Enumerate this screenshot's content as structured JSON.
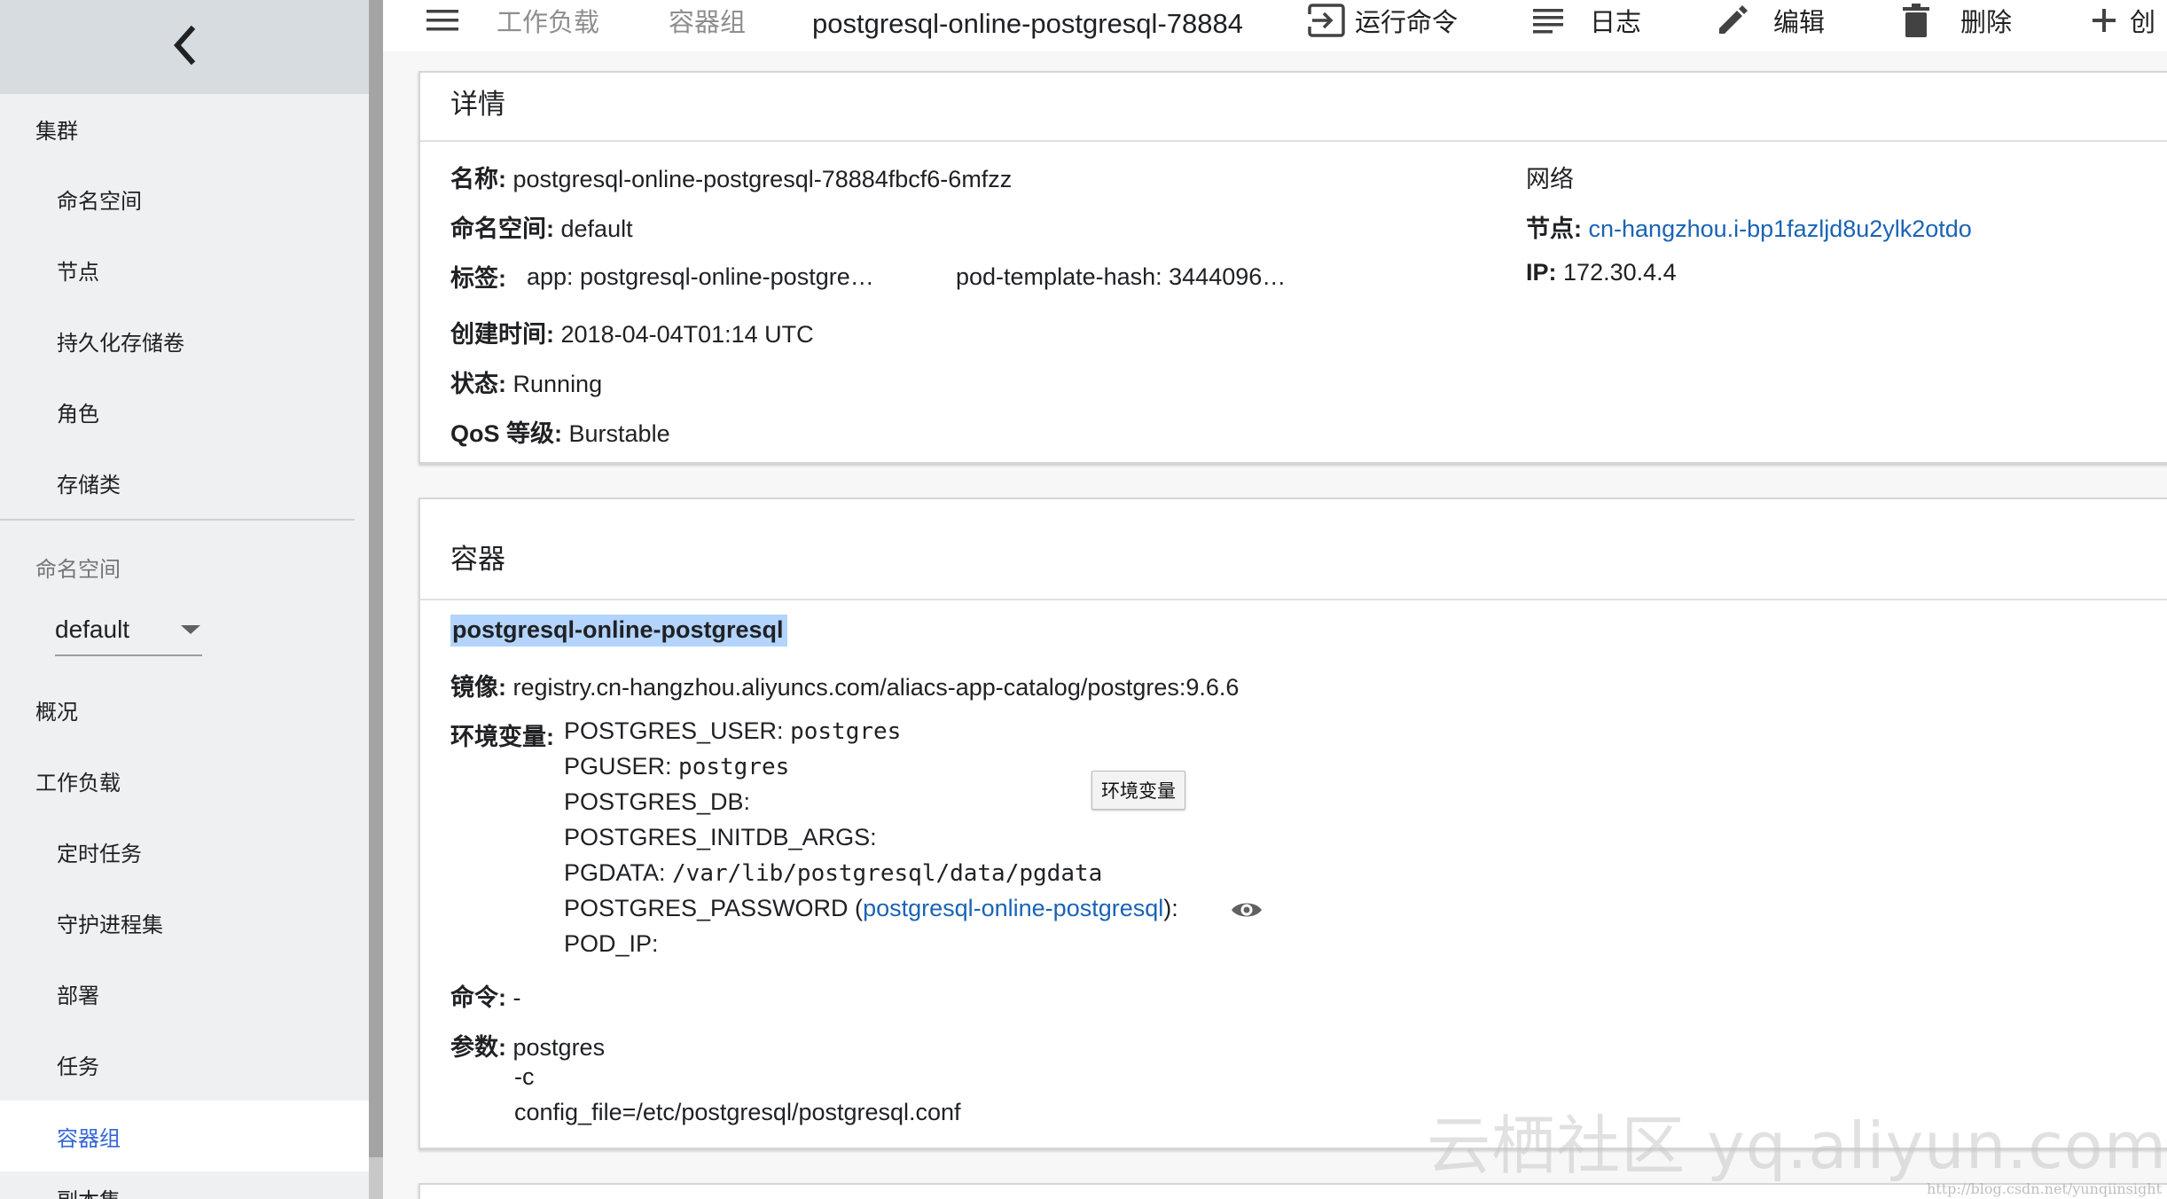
{
  "toolbar": {
    "crumbs": [
      "工作负载",
      "容器组"
    ],
    "title": "postgresql-online-postgresql-78884",
    "actions": [
      "运行命令",
      "日志",
      "编辑",
      "删除",
      "创"
    ]
  },
  "sidebar": {
    "items": [
      {
        "label": "集群"
      },
      {
        "label": "命名空间"
      },
      {
        "label": "节点"
      },
      {
        "label": "持久化存储卷"
      },
      {
        "label": "角色"
      },
      {
        "label": "存储类"
      },
      {
        "label": "概况"
      },
      {
        "label": "工作负载"
      },
      {
        "label": "定时任务"
      },
      {
        "label": "守护进程集"
      },
      {
        "label": "部署"
      },
      {
        "label": "任务"
      },
      {
        "label": "容器组"
      },
      {
        "label": "副本集"
      }
    ],
    "namespace_label": "命名空间",
    "namespace_value": "default"
  },
  "details": {
    "title": "详情",
    "name_label": "名称:",
    "name_value": "postgresql-online-postgresql-78884fbcf6-6mfzz",
    "namespace_label": "命名空间:",
    "namespace_value": "default",
    "labels_label": "标签:",
    "label_1": "app: postgresql-online-postgre…",
    "label_2": "pod-template-hash: 3444096…",
    "created_label": "创建时间:",
    "created_value": "2018-04-04T01:14 UTC",
    "status_label": "状态:",
    "status_value": "Running",
    "qos_label": "QoS 等级:",
    "qos_value": "Burstable",
    "network_title": "网络",
    "node_label": "节点:",
    "node_value": "cn-hangzhou.i-bp1fazljd8u2ylk2otdo",
    "ip_label": "IP:",
    "ip_value": "172.30.4.4"
  },
  "containers": {
    "title": "容器",
    "container_name": "postgresql-online-postgresql",
    "image_label": "镜像:",
    "image_value": "registry.cn-hangzhou.aliyuncs.com/aliacs-app-catalog/postgres:9.6.6",
    "env_label": "环境变量:",
    "env": [
      {
        "key": "POSTGRES_USER:",
        "value": "postgres"
      },
      {
        "key": "PGUSER:",
        "value": "postgres"
      },
      {
        "key": "POSTGRES_DB:",
        "value": ""
      },
      {
        "key": "POSTGRES_INITDB_ARGS:",
        "value": ""
      },
      {
        "key": "PGDATA:",
        "value": "/var/lib/postgresql/data/pgdata"
      },
      {
        "key": "POSTGRES_PASSWORD (",
        "link": "postgresql-online-postgresql",
        "suffix": "):"
      },
      {
        "key": "POD_IP:",
        "value": ""
      }
    ],
    "env_tooltip": "环境变量",
    "command_label": "命令:",
    "command_value": "-",
    "args_label": "参数:",
    "args": [
      "postgres",
      "-c",
      "config_file=/etc/postgresql/postgresql.conf"
    ]
  },
  "watermark": {
    "text": "云栖社区 yq.aliyun.com",
    "url": "http://blog.csdn.net/yunqiinsight"
  }
}
